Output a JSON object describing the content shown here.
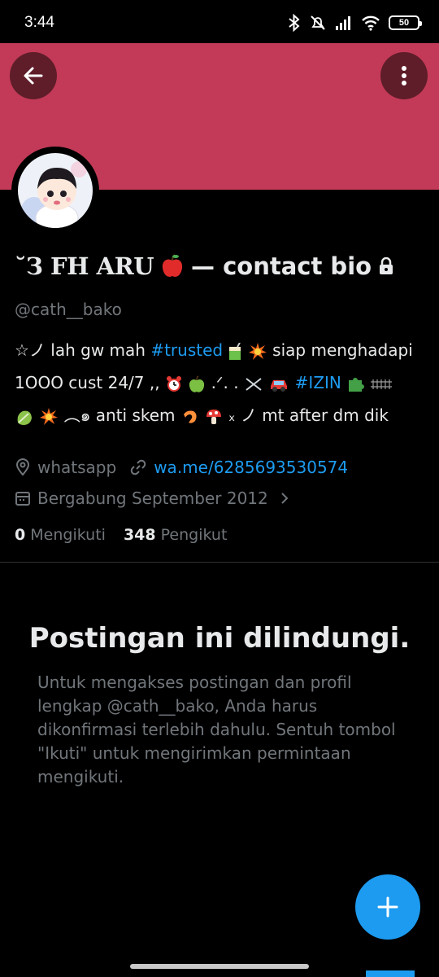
{
  "status_bar": {
    "time": "3:44",
    "battery": "50"
  },
  "profile": {
    "banner_color": "#c23a57",
    "name_part1": "˘З FH ARU",
    "name_part2": "— contact bio",
    "handle": "@cath__bako",
    "bio": {
      "line1_a": "☆ノ lah gw mah ",
      "hashtag1": "#trusted",
      "line1_b": " siap menghadapi",
      "line2_a": "1OOO cust 24/7 ,, ",
      "line2_b": " .ᐟ. . ",
      "hashtag2": "#IZIN",
      "line3_a": " ︵๑ anti skem ",
      "line3_b": " ₓ ノ mt after dm dik"
    },
    "location": "whatsapp",
    "website": "wa.me/6285693530574",
    "joined": "Bergabung September 2012",
    "following_count": "0",
    "following_label": "Mengikuti",
    "followers_count": "348",
    "followers_label": "Pengikut"
  },
  "protected": {
    "title": "Postingan ini dilindungi.",
    "body": "Untuk mengakses postingan dan profil lengkap @cath__bako, Anda harus dikonfirmasi terlebih dahulu. Sentuh tombol \"Ikuti\" untuk mengirimkan permintaan mengikuti."
  },
  "colors": {
    "accent": "#1d9bf0",
    "background": "#000000",
    "secondary_text": "#71767b"
  },
  "icons": [
    "back-arrow-icon",
    "more-vertical-icon",
    "location-icon",
    "link-icon",
    "calendar-icon",
    "chevron-right-icon",
    "compose-plus-icon"
  ]
}
